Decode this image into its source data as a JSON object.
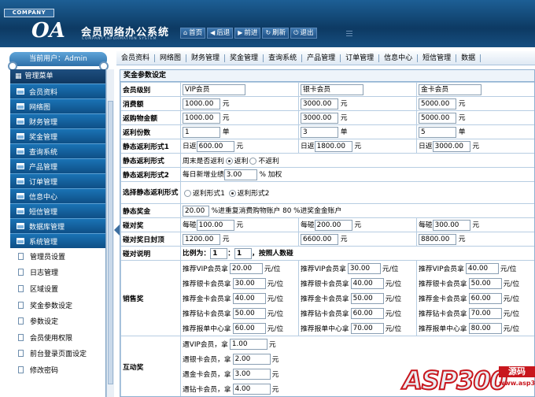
{
  "header": {
    "company": "COMPANY",
    "logo": "OA",
    "app_title": "会员网络办公系统",
    "app_subtitle": "COMPANY INFORMATION SYSTEM",
    "buttons": [
      {
        "icon": "home-icon",
        "label": "首页"
      },
      {
        "icon": "back-icon",
        "label": "后退"
      },
      {
        "icon": "forward-icon",
        "label": "前进"
      },
      {
        "icon": "refresh-icon",
        "label": "刷新"
      },
      {
        "icon": "power-icon",
        "label": "退出"
      }
    ]
  },
  "user_bar": "当前用户：Admin",
  "top_nav": [
    "会员资料",
    "网络图",
    "财务管理",
    "奖金管理",
    "查询系统",
    "产品管理",
    "订单管理",
    "信息中心",
    "短信管理",
    "数据"
  ],
  "sidebar": {
    "title": "管理菜单",
    "groups": [
      "会员资料",
      "网络图",
      "财务管理",
      "奖金管理",
      "查询系统",
      "产品管理",
      "订单管理",
      "信息中心",
      "短信管理",
      "数据库管理",
      "系统管理"
    ],
    "subitems": [
      "管理员设置",
      "日志管理",
      "区域设置",
      "奖金参数设定",
      "参数设定",
      "会员使用权限",
      "前台登录页面设定",
      "修改密码"
    ]
  },
  "page_title": "奖金参数设定",
  "form": {
    "row_level": {
      "label": "会员级别",
      "vals": [
        "VIP会员",
        "银卡会员",
        "金卡会员"
      ]
    },
    "row_fee": {
      "label": "消费额",
      "vals": [
        "1000.00",
        "3000.00",
        "5000.00"
      ],
      "unit": "元"
    },
    "row_refund": {
      "label": "返购物金额",
      "vals": [
        "1000.00",
        "3000.00",
        "5000.00"
      ],
      "unit": "元"
    },
    "row_shares": {
      "label": "返利份数",
      "vals": [
        "1",
        "3",
        "5"
      ],
      "unit": "单"
    },
    "row_static1": {
      "label": "静态返利形式1",
      "prefix": "日返",
      "vals": [
        "600.00",
        "1800.00",
        "3000.00"
      ],
      "unit": "元"
    },
    "row_static_mode": {
      "label": "静态返利形式",
      "opt1": "周末是否返利",
      "opt2": "返利",
      "opt3": "不返利"
    },
    "row_static2": {
      "label": "静态返利形式2",
      "prefix": "每日新增业绩",
      "value": "3.00",
      "suffix": "% 加权"
    },
    "row_choose": {
      "label": "选择静态返利形式",
      "opt1": "返利形式1",
      "opt2": "返利形式2"
    },
    "row_static_bonus": {
      "label": "静态奖金",
      "value": "20.00",
      "suffix": "%进重复消费购物账户 80 %进奖金金账户"
    },
    "row_collide": {
      "label": "碰对奖",
      "prefix": "每碰",
      "vals": [
        "100.00",
        "200.00",
        "300.00"
      ],
      "unit": "元"
    },
    "row_collide_cap": {
      "label": "碰对奖日封顶",
      "vals": [
        "1200.00",
        "6600.00",
        "8800.00"
      ],
      "unit": "元"
    },
    "row_collide_note": {
      "label": "碰对说明",
      "p1": "比例为：",
      "a": "1",
      "colon": "：",
      "b": "1",
      "p2": "，按照人数碰"
    },
    "row_sales": {
      "label": "销售奖",
      "prefixes": [
        "推荐VIP会员拿",
        "推荐银卡会员拿",
        "推荐金卡会员拿",
        "推荐钻卡会员拿",
        "推荐报单中心拿"
      ],
      "cols": [
        [
          "20.00",
          "30.00",
          "40.00",
          "50.00",
          "60.00"
        ],
        [
          "30.00",
          "40.00",
          "50.00",
          "60.00",
          "70.00"
        ],
        [
          "40.00",
          "50.00",
          "60.00",
          "70.00",
          "80.00"
        ]
      ],
      "unit": "元/位"
    },
    "row_interact": {
      "label": "互动奖",
      "prefixes": [
        "遇VIP会员，拿",
        "遇银卡会员，拿",
        "遇金卡会员，拿",
        "遇钻卡会员，拿"
      ],
      "vals": [
        "1.00",
        "2.00",
        "3.00",
        "4.00"
      ],
      "unit": "元"
    }
  },
  "watermark": {
    "text": "ASP300",
    "badge": "源码",
    "url": "www.asp300.com"
  }
}
